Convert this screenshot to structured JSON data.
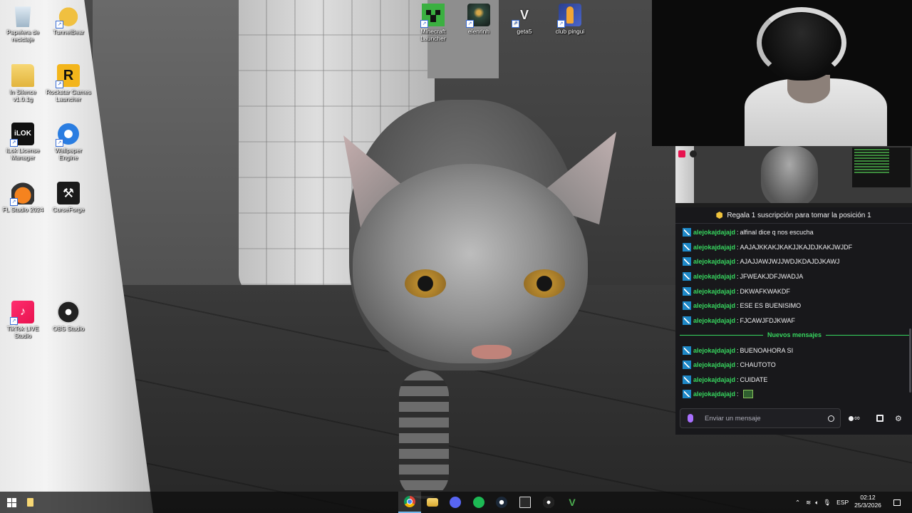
{
  "desktop": {
    "icons": [
      {
        "label": "Papelera de reciclaje",
        "icon": "recycle-bin-icon"
      },
      {
        "label": "TunnelBear",
        "icon": "bear-icon"
      },
      {
        "label": "In Silence v1.0.1g",
        "icon": "folder-icon"
      },
      {
        "label": "Rockstar Games Launcher",
        "icon": "rockstar-icon"
      },
      {
        "label": "iLok License Manager",
        "icon": "ilok-icon"
      },
      {
        "label": "Wallpaper Engine",
        "icon": "wallpaper-engine-icon"
      },
      {
        "label": "FL Studio 2024",
        "icon": "fl-studio-icon"
      },
      {
        "label": "CurseForge",
        "icon": "curseforge-icon"
      },
      {
        "label": "TikTok LIVE Studio",
        "icon": "tiktok-icon"
      },
      {
        "label": "OBS Studio",
        "icon": "obs-icon"
      },
      {
        "label": "Minecraft Launcher",
        "icon": "minecraft-icon"
      },
      {
        "label": "elenrinh",
        "icon": "elden-ring-icon"
      },
      {
        "label": "geta5",
        "icon": "gta5-icon"
      },
      {
        "label": "club pingui",
        "icon": "counter-strike-icon"
      }
    ]
  },
  "chat": {
    "pinned_text": "Regala 1 suscripción para tomar la posición 1",
    "messages": [
      {
        "user": "alejokajdajajd",
        "text": "alfinal dice q nos escucha"
      },
      {
        "user": "alejokajdajajd",
        "text": "AAJAJKKAKJKAKJJKAJDJKAKJWJDF"
      },
      {
        "user": "alejokajdajajd",
        "text": "AJAJJAWJWJJWDJKDAJDJKAWJ"
      },
      {
        "user": "alejokajdajajd",
        "text": "JFWEAKJDFJWADJA"
      },
      {
        "user": "alejokajdajajd",
        "text": "DKWAFKWAKDF"
      },
      {
        "user": "alejokajdajajd",
        "text": "ESE ES BUENISIMO"
      },
      {
        "user": "alejokajdajajd",
        "text": "FJCAWJFDJKWAF"
      }
    ],
    "divider": "Nuevos mensajes",
    "new_messages": [
      {
        "user": "alejokajdajajd",
        "text": "BUENOAHORA SI"
      },
      {
        "user": "alejokajdajajd",
        "text": "CHAUTOTO"
      },
      {
        "user": "alejokajdajajd",
        "text": "CUIDATE"
      },
      {
        "user": "alejokajdajajd",
        "text": "",
        "emote": "emote-icon"
      }
    ],
    "input_placeholder": "Enviar un mensaje",
    "colors": {
      "username": "#37d65f",
      "mic": "#a970ff",
      "panel": "#18181b"
    }
  },
  "taskbar": {
    "apps": [
      "start-icon",
      "file-explorer-icon",
      "chrome-icon",
      "files-icon",
      "discord-icon",
      "spotify-icon",
      "steam-icon",
      "epic-games-icon",
      "obs-icon",
      "vegas-icon"
    ],
    "language": "ESP",
    "time": "02:12",
    "date": "25/3/2026"
  }
}
